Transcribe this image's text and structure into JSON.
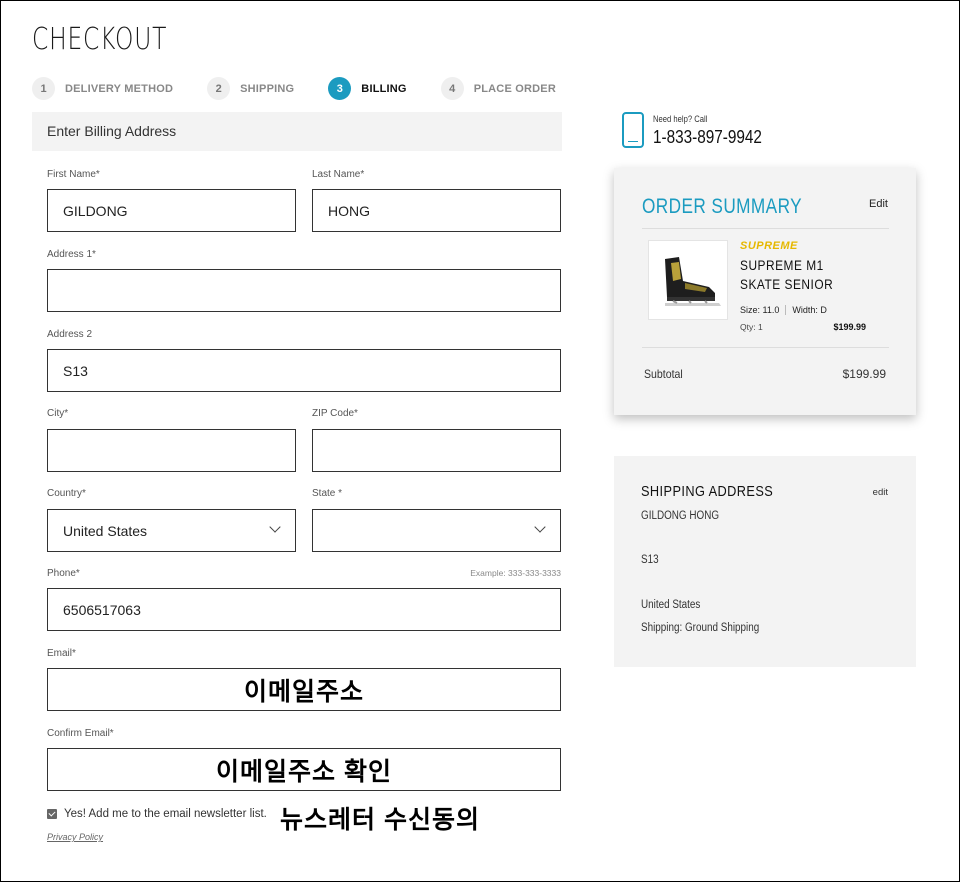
{
  "page": {
    "title": "CHECKOUT"
  },
  "steps": [
    {
      "num": "1",
      "label": "DELIVERY METHOD",
      "active": false
    },
    {
      "num": "2",
      "label": "SHIPPING",
      "active": false
    },
    {
      "num": "3",
      "label": "BILLING",
      "active": true
    },
    {
      "num": "4",
      "label": "PLACE ORDER",
      "active": false
    }
  ],
  "billing": {
    "section_title": "Enter Billing Address",
    "first_name": {
      "label": "First Name*",
      "value": "GILDONG"
    },
    "last_name": {
      "label": "Last Name*",
      "value": "HONG"
    },
    "address1": {
      "label": "Address 1*",
      "value": ""
    },
    "address2": {
      "label": "Address 2",
      "value": "S13"
    },
    "city": {
      "label": "City*",
      "value": ""
    },
    "zip": {
      "label": "ZIP Code*",
      "value": ""
    },
    "country": {
      "label": "Country*",
      "value": "United States"
    },
    "state": {
      "label": "State *",
      "value": ""
    },
    "phone": {
      "label": "Phone*",
      "example": "Example: 333-333-3333",
      "value": "6506517063"
    },
    "email": {
      "label": "Email*",
      "overlay": "이메일주소"
    },
    "confirm_email": {
      "label": "Confirm Email*",
      "overlay": "이메일주소 확인"
    },
    "newsletter": {
      "label": "Yes! Add me to the email newsletter list.",
      "checked": true,
      "overlay": "뉴스레터 수신동의"
    },
    "privacy_link": "Privacy Policy"
  },
  "help": {
    "small": "Need help? Call",
    "phone": "1-833-897-9942",
    "icon": "phone-icon"
  },
  "summary": {
    "title": "ORDER SUMMARY",
    "edit": "Edit",
    "item": {
      "brand": "SUPREME",
      "name": "SUPREME M1 SKATE SENIOR",
      "size": "Size: 11.0",
      "width": "Width: D",
      "qty": "Qty: 1",
      "price": "$199.99"
    },
    "subtotal_label": "Subtotal",
    "subtotal_value": "$199.99"
  },
  "shipping_address": {
    "title": "SHIPPING ADDRESS",
    "edit": "edit",
    "name": "GILDONG HONG",
    "line1": "S13",
    "country": "United States",
    "method": "Shipping: Ground Shipping"
  },
  "colors": {
    "accent": "#1b9bc0",
    "brand_gold": "#e6b800",
    "panel": "#f3f3f3"
  }
}
